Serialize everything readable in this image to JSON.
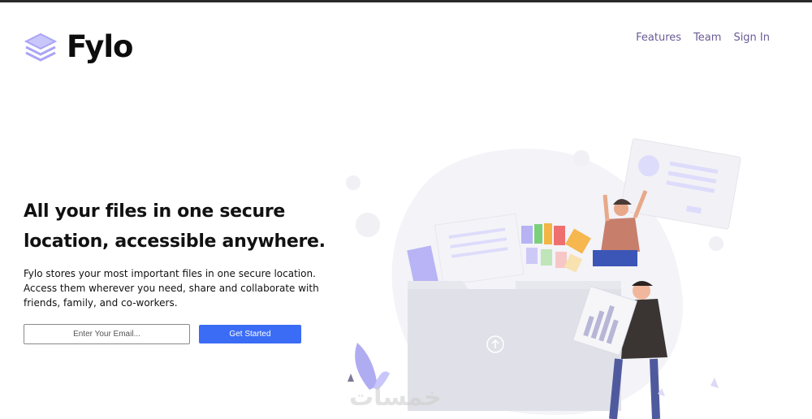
{
  "brand": {
    "name": "Fylo",
    "logo_icon": "stacked-layers-icon",
    "logo_color": "#a9a4f7"
  },
  "nav": {
    "items": [
      {
        "label": "Features"
      },
      {
        "label": "Team"
      },
      {
        "label": "Sign In"
      }
    ],
    "color": "#6b5b95"
  },
  "hero": {
    "headline": "All your files in one secure location, accessible anywhere.",
    "description": "Fylo stores your most important files in one secure location. Access them wherever you need, share and collaborate with friends, family, and co-workers.",
    "email_placeholder": "Enter Your Email...",
    "cta_label": "Get Started",
    "cta_color": "#3b6cf5"
  },
  "illustration": {
    "name": "people-organizing-files-illustration",
    "watermark": "خمسات"
  }
}
